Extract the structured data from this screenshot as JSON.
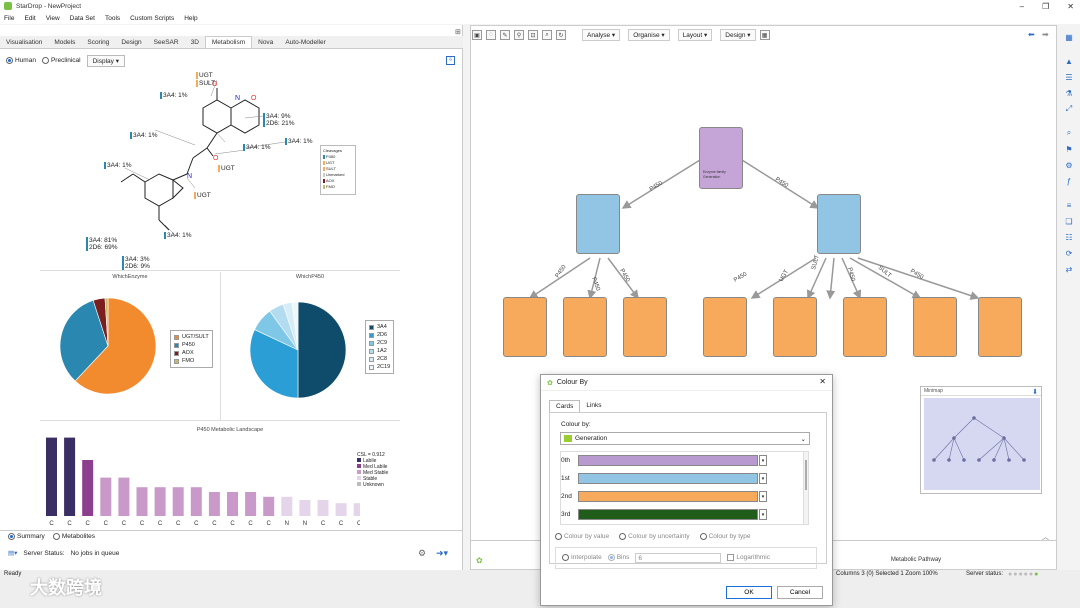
{
  "window": {
    "title": "StarDrop - NewProject"
  },
  "menu": [
    "File",
    "Edit",
    "View",
    "Data Set",
    "Tools",
    "Custom Scripts",
    "Help"
  ],
  "tabs": [
    "Visualisation",
    "Models",
    "Scoring",
    "Design",
    "SeeSAR",
    "3D",
    "Metabolism",
    "Nova",
    "Auto-Modeller"
  ],
  "active_tab": "Metabolism",
  "options": {
    "human": "Human",
    "preclinical": "Preclinical",
    "display": "Display"
  },
  "labels": {
    "ugt_top": "UGT",
    "sult_top": "SULT",
    "l1": "3A4: 1%",
    "l2a": "3A4: 9%",
    "l2b": "2D6: 21%",
    "l3": "3A4: 1%",
    "l4": "3A4: 1%",
    "l5": "3A4: 1%",
    "l6": "3A4: 1%",
    "ugt_mid": "UGT",
    "ugt_low": "UGT",
    "l7": "3A4: 1%",
    "l8a": "3A4: 81%",
    "l8b": "2D6: 69%",
    "l9a": "3A4: 3%",
    "l9b": "2D6: 9%"
  },
  "legend_struct": {
    "title": "Cleavages",
    "items": [
      "P450",
      "UGT",
      "SULT",
      "Unmarked",
      "AOX",
      "FMO"
    ]
  },
  "left_status": {
    "summary": "Summary",
    "metabolites": "Metabolites",
    "server": "Server Status:",
    "jobs": "No jobs in queue",
    "ready": "Ready"
  },
  "right_toolbar": {
    "analyse": "Analyse",
    "organise": "Organise",
    "layout": "Layout",
    "design": "Design"
  },
  "pathway": {
    "title": "Metabolic Pathway",
    "minimap": "Minimap",
    "edges": [
      "P450",
      "P450",
      "P450",
      "P450",
      "P450",
      "P450",
      "UGT",
      "SULT",
      "P450",
      "SULT",
      "P450"
    ],
    "node_legend": [
      "Enzyme family",
      "Generation"
    ]
  },
  "status_right": {
    "text": "Columns 3 (0) Selected 1 Zoom 100%",
    "server": "Server status:"
  },
  "colors": {
    "gen0": "#b89ad0",
    "gen1": "#92c5e3",
    "gen2": "#f7aa5c",
    "gen3": "#205c1a",
    "accent": "#1e6fd9"
  },
  "dialog": {
    "title": "Colour By",
    "tabs": [
      "Cards",
      "Links"
    ],
    "colour_by_label": "Colour by:",
    "colour_by_value": "Generation",
    "rows": [
      {
        "label": "0th",
        "color": "#b89ad0"
      },
      {
        "label": "1st",
        "color": "#92c5e3"
      },
      {
        "label": "2nd",
        "color": "#f7aa5c"
      },
      {
        "label": "3rd",
        "color": "#205c1a"
      }
    ],
    "modes": [
      "Colour by value",
      "Colour by uncertainty",
      "Colour by type"
    ],
    "interpolate": "Interpolate",
    "bins": "Bins",
    "bins_value": "6",
    "logarithmic": "Logarithmic",
    "ok": "OK",
    "cancel": "Cancel"
  },
  "watermark": "大数跨境",
  "chart_data": [
    {
      "type": "pie",
      "title": "WhichEnzyme",
      "categories": [
        "UGT/SULT",
        "P450",
        "AOX",
        "FMO"
      ],
      "values": [
        62,
        33,
        4,
        1
      ],
      "colors": [
        "#f28a2e",
        "#2a88b0",
        "#7a1f1f",
        "#c7b96a"
      ]
    },
    {
      "type": "pie",
      "title": "WhichP450",
      "categories": [
        "3A4",
        "2D6",
        "2C9",
        "1A2",
        "2C8",
        "2C19"
      ],
      "values": [
        50,
        32,
        8,
        5,
        3,
        2
      ],
      "colors": [
        "#0f4c6b",
        "#2b9ed6",
        "#7fc7e7",
        "#b3dcf0",
        "#d6ecf6",
        "#eef7fb"
      ]
    },
    {
      "type": "bar",
      "title": "P450 Metabolic Landscape",
      "categories": [
        "C",
        "C",
        "C",
        "C",
        "C",
        "C",
        "C",
        "C",
        "C",
        "C",
        "C",
        "C",
        "C",
        "N",
        "N",
        "C",
        "C",
        "C"
      ],
      "values": [
        0.98,
        0.98,
        0.7,
        0.48,
        0.48,
        0.36,
        0.36,
        0.36,
        0.36,
        0.3,
        0.3,
        0.3,
        0.24,
        0.24,
        0.2,
        0.2,
        0.16,
        0.16
      ],
      "colors": [
        "#3a2e63",
        "#3a2e63",
        "#8b3f8c",
        "#c99ac9",
        "#c99ac9",
        "#c99ac9",
        "#c99ac9",
        "#c99ac9",
        "#c99ac9",
        "#c99ac9",
        "#c99ac9",
        "#c99ac9",
        "#c99ac9",
        "#e5d5ea",
        "#e5d5ea",
        "#e5d5ea",
        "#e5d5ea",
        "#e5d5ea"
      ],
      "legend": {
        "csl": "CSL = 0.912",
        "items": [
          {
            "name": "Labile",
            "color": "#3a2e63"
          },
          {
            "name": "Med Labile",
            "color": "#8b3f8c"
          },
          {
            "name": "Med Stable",
            "color": "#c99ac9"
          },
          {
            "name": "Stable",
            "color": "#e5d5ea"
          },
          {
            "name": "Unknown",
            "color": "#bbbbbb"
          }
        ]
      }
    }
  ]
}
